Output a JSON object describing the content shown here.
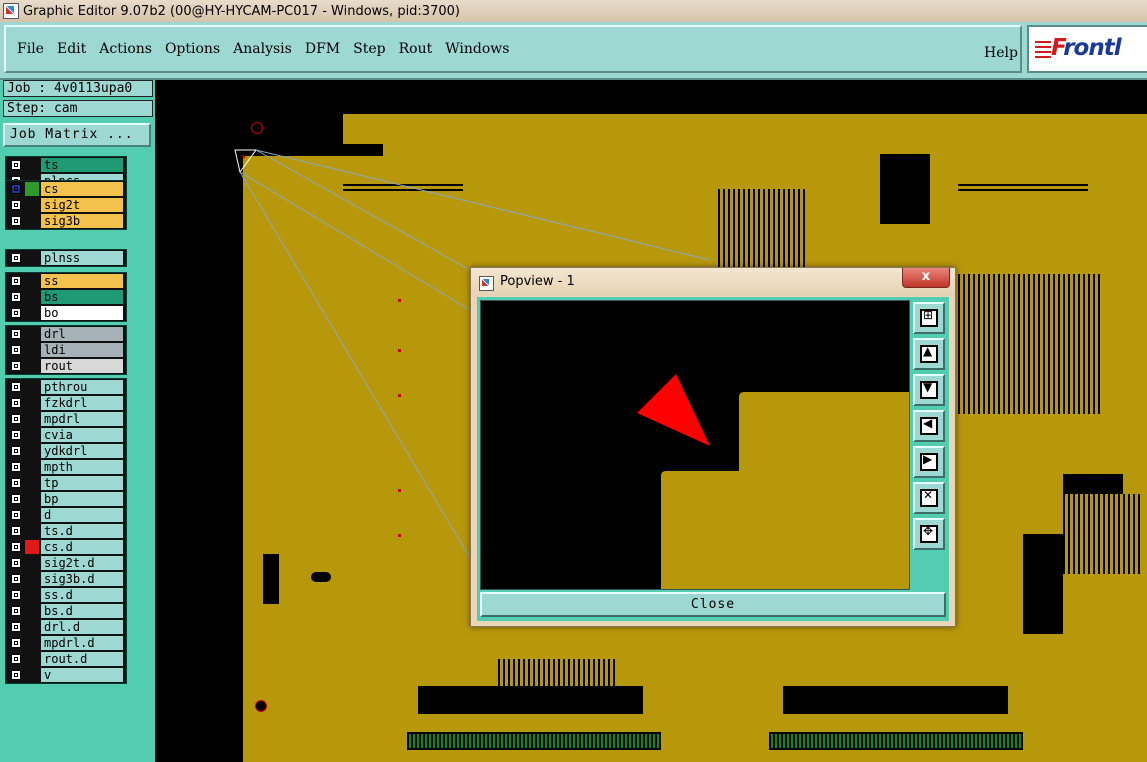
{
  "window": {
    "title": "Graphic Editor 9.07b2 (00@HY-HYCAM-PC017 - Windows, pid:3700)"
  },
  "menu": {
    "items": [
      {
        "label": "File"
      },
      {
        "label": "Edit"
      },
      {
        "label": "Actions"
      },
      {
        "label": "Options"
      },
      {
        "label": "Analysis"
      },
      {
        "label": "DFM"
      },
      {
        "label": "Step"
      },
      {
        "label": "Rout"
      },
      {
        "label": "Windows"
      }
    ],
    "help": "Help",
    "logo": {
      "prefix": "F",
      "rest": "rontl"
    }
  },
  "panel": {
    "job": "Job : 4v0113upa0",
    "step": "Step: cam",
    "job_matrix": "Job Matrix ..."
  },
  "layers": [
    {
      "name": "ts",
      "color": "#1e9b73",
      "sq": "#111"
    },
    {
      "name": "plncs",
      "color": "#9ed8d3",
      "sq": "#111"
    },
    {
      "name": "cs",
      "color": "#f2c24c",
      "sq": "#2c9a2c",
      "active": true
    },
    {
      "name": "sig2t",
      "color": "#f2c24c",
      "sq": "#111"
    },
    {
      "name": "sig3b",
      "color": "#f2c24c",
      "sq": "#111"
    },
    {
      "name": "plnss",
      "color": "#9ed8d3",
      "sq": "#111"
    },
    {
      "name": "ss",
      "color": "#f2c24c",
      "sq": "#111"
    },
    {
      "name": "bs",
      "color": "#1e9b73",
      "sq": "#111"
    },
    {
      "name": "bo",
      "color": "#ffffff",
      "sq": "#111"
    },
    {
      "name": "drl",
      "color": "#a7b1b8",
      "sq": "#111"
    },
    {
      "name": "ldi",
      "color": "#a7b1b8",
      "sq": "#111"
    },
    {
      "name": "rout",
      "color": "#d8d8d8",
      "sq": "#111"
    },
    {
      "name": "pthrou",
      "color": "#9ed8d3",
      "sq": "#111"
    },
    {
      "name": "fzkdrl",
      "color": "#9ed8d3",
      "sq": "#111"
    },
    {
      "name": "mpdrl",
      "color": "#9ed8d3",
      "sq": "#111"
    },
    {
      "name": "cvia",
      "color": "#9ed8d3",
      "sq": "#111"
    },
    {
      "name": "ydkdrl",
      "color": "#9ed8d3",
      "sq": "#111"
    },
    {
      "name": "mpth",
      "color": "#9ed8d3",
      "sq": "#111"
    },
    {
      "name": "tp",
      "color": "#9ed8d3",
      "sq": "#111"
    },
    {
      "name": "bp",
      "color": "#9ed8d3",
      "sq": "#111"
    },
    {
      "name": "d",
      "color": "#9ed8d3",
      "sq": "#111"
    },
    {
      "name": "ts.d",
      "color": "#9ed8d3",
      "sq": "#111"
    },
    {
      "name": "cs.d",
      "color": "#9ed8d3",
      "sq": "#e01818"
    },
    {
      "name": "sig2t.d",
      "color": "#9ed8d3",
      "sq": "#111"
    },
    {
      "name": "sig3b.d",
      "color": "#9ed8d3",
      "sq": "#111"
    },
    {
      "name": "ss.d",
      "color": "#9ed8d3",
      "sq": "#111"
    },
    {
      "name": "bs.d",
      "color": "#9ed8d3",
      "sq": "#111"
    },
    {
      "name": "drl.d",
      "color": "#9ed8d3",
      "sq": "#111"
    },
    {
      "name": "mpdrl.d",
      "color": "#9ed8d3",
      "sq": "#111"
    },
    {
      "name": "rout.d",
      "color": "#9ed8d3",
      "sq": "#111"
    },
    {
      "name": "v",
      "color": "#9ed8d3",
      "sq": "#111"
    }
  ],
  "popview": {
    "title": "Popview - 1",
    "close_x": "x",
    "close_label": "Close",
    "tools": [
      "zoom-fit-icon",
      "pan-up-icon",
      "pan-down-icon",
      "pan-left-icon",
      "pan-right-icon",
      "zoom-out-icon",
      "zoom-in-icon"
    ]
  },
  "colors": {
    "board": "#b8980b",
    "panel": "#52cdb0",
    "button": "#9ed8d3",
    "marker": "#ff0000"
  }
}
